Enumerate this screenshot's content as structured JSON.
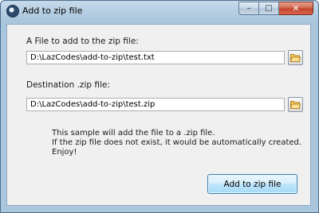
{
  "window": {
    "title": "Add to zip file",
    "icon": "app-icon",
    "controls": {
      "minimize": "–",
      "maximize": "□",
      "close": "✕"
    }
  },
  "form": {
    "source_label": "A File to add to the zip file:",
    "source_value": "D:\\LazCodes\\add-to-zip\\test.txt",
    "source_browse_icon": "folder-open-icon",
    "dest_label": "Destination .zip file:",
    "dest_value": "D:\\LazCodes\\add-to-zip\\test.zip",
    "dest_browse_icon": "folder-open-icon"
  },
  "info": {
    "lines": [
      "This sample will add the file to a .zip file.",
      "If the zip file does not exist, it would be automatically created.",
      "Enjoy!"
    ]
  },
  "actions": {
    "add_label": "Add to zip file"
  },
  "colors": {
    "frame": "#aac6dd",
    "client": "#f0f0f0",
    "close_button": "#c2412b",
    "default_button": "#bee6fd"
  }
}
